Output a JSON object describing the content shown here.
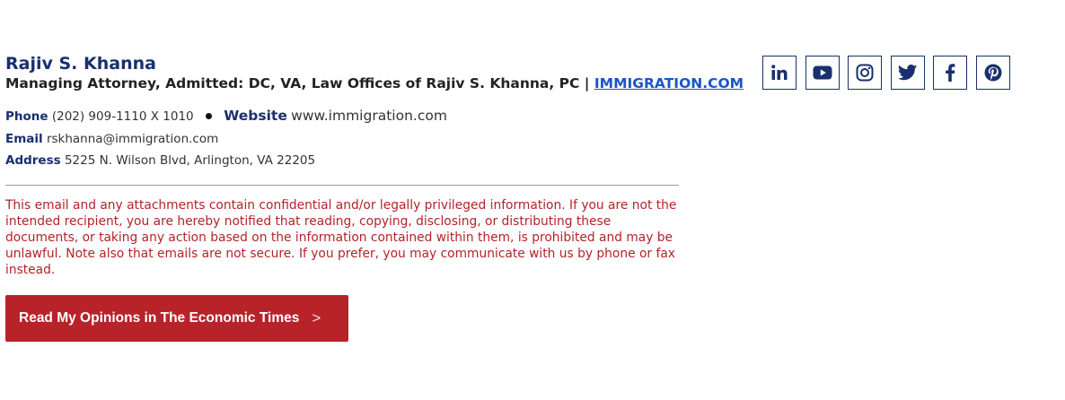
{
  "signature": {
    "name": "Rajiv S. Khanna",
    "title_prefix": "Managing Attorney, Admitted: DC, VA, Law Offices of Rajiv S. Khanna, PC |",
    "title_link": "IMMIGRATION.COM",
    "phone_label": "Phone",
    "phone_value": "(202) 909-1110 X 1010",
    "website_label": "Website",
    "website_value": "www.immigration.com",
    "email_label": "Email",
    "email_value": "rskhanna@immigration.com",
    "address_label": "Address",
    "address_value": "5225 N. Wilson Blvd, Arlington, VA 22205"
  },
  "disclaimer": "This email and any attachments contain confidential and/or legally privileged information. If you are not the intended recipient, you are hereby notified that reading, copying, disclosing, or distributing these documents, or taking any action based on the information contained within them, is prohibited and may be unlawful. Note also that emails are not secure. If you prefer, you may communicate with us by phone or fax instead.",
  "cta": {
    "label": "Read My Opinions in The Economic Times",
    "chevron": ">"
  },
  "social": [
    {
      "name": "linkedin-icon"
    },
    {
      "name": "youtube-icon"
    },
    {
      "name": "instagram-icon"
    },
    {
      "name": "twitter-icon"
    },
    {
      "name": "facebook-icon"
    },
    {
      "name": "pinterest-icon"
    }
  ],
  "colors": {
    "navy": "#1a2f6e",
    "link": "#1a56c6",
    "disclaimer_red": "#b3232a",
    "button_red": "#b8232a"
  }
}
